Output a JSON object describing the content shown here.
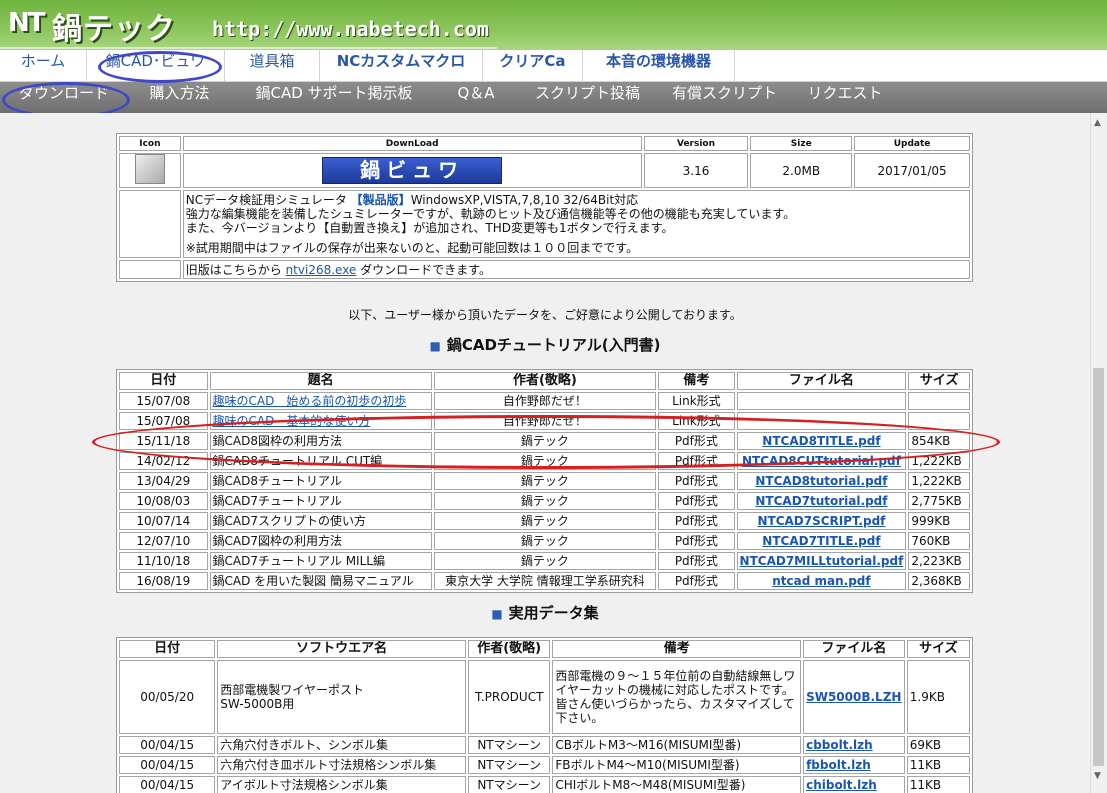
{
  "header": {
    "logo_mark": "NT",
    "logo_text": "鍋テック",
    "url": "http://www.nabetech.com"
  },
  "nav_primary": [
    "ホーム",
    "鍋CAD･ビュワ",
    "道具箱",
    "NCカスタムマクロ",
    "クリアCa",
    "本音の環境機器"
  ],
  "nav_secondary": [
    "ダウンロード",
    "購入方法",
    "鍋CAD サポート掲示板",
    "Q＆A",
    "スクリプト投稿",
    "有償スクリプト",
    "リクエスト"
  ],
  "download": {
    "headers": [
      "Icon",
      "DownLoad",
      "Version",
      "Size",
      "Update"
    ],
    "product_button": "鍋ビュワ",
    "version": "3.16",
    "size": "2.0MB",
    "update": "2017/01/05",
    "desc_line1_prefix": "NCデータ検証用シミュレータ ",
    "desc_line1_badge": "【製品版】",
    "desc_line1_suffix": "WindowsXP,VISTA,7,8,10 32/64Bit対応",
    "desc_line2": "強力な編集機能を装備したシュミレーターですが、軌跡のヒット及び通信機能等その他の機能も充実しています。",
    "desc_line3": "また、今バージョンより【自動置き換え】が追加され、THD変更等も1ボタンで行えます。",
    "desc_line4": "※試用期間中はファイルの保存が出来ないのと、起動可能回数は１００回までです。",
    "old_prefix": "旧版はこちらから ",
    "old_link": "ntvi268.exe",
    "old_suffix": " ダウンロードできます。"
  },
  "intro": "以下、ユーザー様から頂いたデータを、ご好意により公開しております。",
  "tutorial": {
    "title": "鍋CADチュートリアル(入門書)",
    "headers": [
      "日付",
      "題名",
      "作者(敬略)",
      "備考",
      "ファイル名",
      "サイズ"
    ],
    "rows": [
      [
        "15/07/08",
        "趣味のCAD　始める前の初歩の初歩",
        "自作野郎だぜ！",
        "Link形式",
        "",
        ""
      ],
      [
        "15/07/08",
        "趣味のCAD　基本的な使い方",
        "自作野郎だぜ！",
        "Link形式",
        "",
        ""
      ],
      [
        "15/11/18",
        "鍋CAD8図枠の利用方法",
        "鍋テック",
        "Pdf形式",
        "NTCAD8TITLE.pdf",
        "854KB"
      ],
      [
        "14/02/12",
        "鍋CAD8チュートリアル CUT編",
        "鍋テック",
        "Pdf形式",
        "NTCAD8CUTtutorial.pdf",
        "1,222KB"
      ],
      [
        "13/04/29",
        "鍋CAD8チュートリアル",
        "鍋テック",
        "Pdf形式",
        "NTCAD8tutorial.pdf",
        "1,222KB"
      ],
      [
        "10/08/03",
        "鍋CAD7チュートリアル",
        "鍋テック",
        "Pdf形式",
        "NTCAD7tutorial.pdf",
        "2,775KB"
      ],
      [
        "10/07/14",
        "鍋CAD7スクリプトの使い方",
        "鍋テック",
        "Pdf形式",
        "NTCAD7SCRIPT.pdf",
        "999KB"
      ],
      [
        "12/07/10",
        "鍋CAD7図枠の利用方法",
        "鍋テック",
        "Pdf形式",
        "NTCAD7TITLE.pdf",
        "760KB"
      ],
      [
        "11/10/18",
        "鍋CAD7チュートリアル MILL編",
        "鍋テック",
        "Pdf形式",
        "NTCAD7MILLtutorial.pdf",
        "2,223KB"
      ],
      [
        "16/08/19",
        "鍋CAD を用いた製図 簡易マニュアル",
        "東京大学 大学院 情報理工学系研究科",
        "Pdf形式",
        "ntcad man.pdf",
        "2,368KB"
      ]
    ]
  },
  "practical": {
    "title": "実用データ集",
    "headers": [
      "日付",
      "ソフトウエア名",
      "作者(敬略)",
      "備考",
      "ファイル名",
      "サイズ"
    ],
    "rows": [
      [
        "00/05/20",
        "西部電機製ワイヤーポスト\nSW-5000B用",
        "T.PRODUCT",
        "西部電機の９～１５年位前の自動結線無しワイヤーカットの機械に対応したポストです。\n皆さん使いづらかったら、カスタマイズして下さい。",
        "SW5000B.LZH",
        "1.9KB"
      ],
      [
        "00/04/15",
        "六角穴付きボルト、シンボル集",
        "NTマシーン",
        "CBボルトM3～M16(MISUMI型番)",
        "cbbolt.lzh",
        "69KB"
      ],
      [
        "00/04/15",
        "六角穴付き皿ボルト寸法規格シンボル集",
        "NTマシーン",
        "FBボルトM4～M10(MISUMI型番)",
        "fbbolt.lzh",
        "11KB"
      ],
      [
        "00/04/15",
        "アイボルト寸法規格シンボル集",
        "NTマシーン",
        "CHIボルトM8～M48(MISUMI型番)",
        "chibolt.lzh",
        "11KB"
      ]
    ]
  },
  "colors": {
    "header_green": "#7bbd4a",
    "nav_link": "#2a56a8",
    "annotation_blue": "#3f49c6",
    "annotation_red": "#d42020"
  }
}
